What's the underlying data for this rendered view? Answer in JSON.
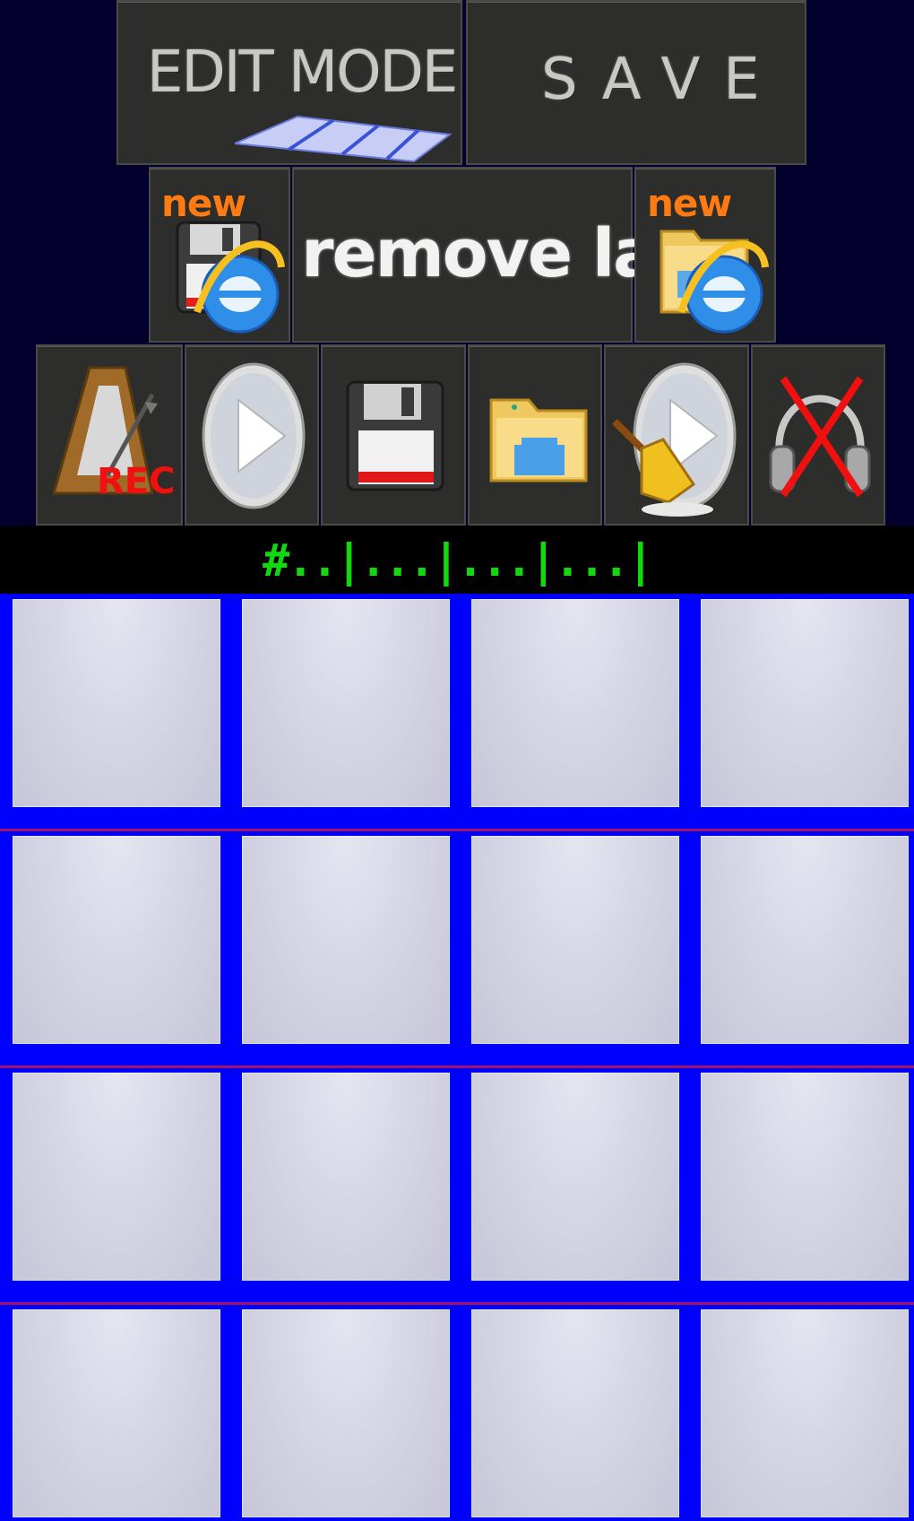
{
  "toolbar_top": {
    "edit_mode_label": "EDIT MODE",
    "save_label": "SAVE"
  },
  "toolbar_mid": {
    "new_tag_left": "new",
    "remove_lag_label": "remove lag",
    "new_tag_right": "new"
  },
  "toolbar_icons": [
    {
      "icon": "metronome-rec-icon",
      "badge": "REC"
    },
    {
      "icon": "play-icon"
    },
    {
      "icon": "floppy-save-icon"
    },
    {
      "icon": "folder-open-icon"
    },
    {
      "icon": "broom-play-icon"
    },
    {
      "icon": "headphones-off-icon"
    }
  ],
  "status": {
    "text": "#..|...|...|...|"
  },
  "pads": {
    "rows": 4,
    "cols": 4,
    "count": 16
  },
  "colors": {
    "background": "#03002e",
    "panel": "#2d2d2b",
    "grid_lines": "#0000ff",
    "status_text": "#12d80e",
    "new_tag": "#ff7a10"
  }
}
